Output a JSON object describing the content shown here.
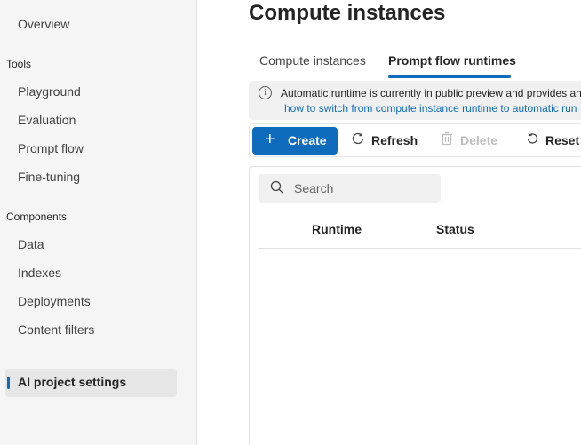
{
  "sidebar": {
    "items_top": [
      {
        "label": "Overview"
      }
    ],
    "groups": [
      {
        "label": "Tools",
        "items": [
          "Playground",
          "Evaluation",
          "Prompt flow",
          "Fine-tuning"
        ]
      },
      {
        "label": "Components",
        "items": [
          "Data",
          "Indexes",
          "Deployments",
          "Content filters"
        ]
      }
    ],
    "active_item": "AI project settings"
  },
  "page": {
    "title": "Compute instances",
    "tabs": [
      {
        "label": "Compute instances",
        "active": false
      },
      {
        "label": "Prompt flow runtimes",
        "active": true
      }
    ]
  },
  "banner": {
    "icon": "info-icon",
    "message": "Automatic runtime is currently in public preview and provides an",
    "link": "how to switch from compute instance runtime to automatic run"
  },
  "toolbar": {
    "create": "Create",
    "refresh": "Refresh",
    "delete": "Delete",
    "reset": "Reset v"
  },
  "table": {
    "search_placeholder": "Search",
    "columns": [
      "Runtime",
      "Status"
    ]
  },
  "colors": {
    "accent": "#0f6cbd",
    "sidebar_bg": "#f5f5f5"
  }
}
